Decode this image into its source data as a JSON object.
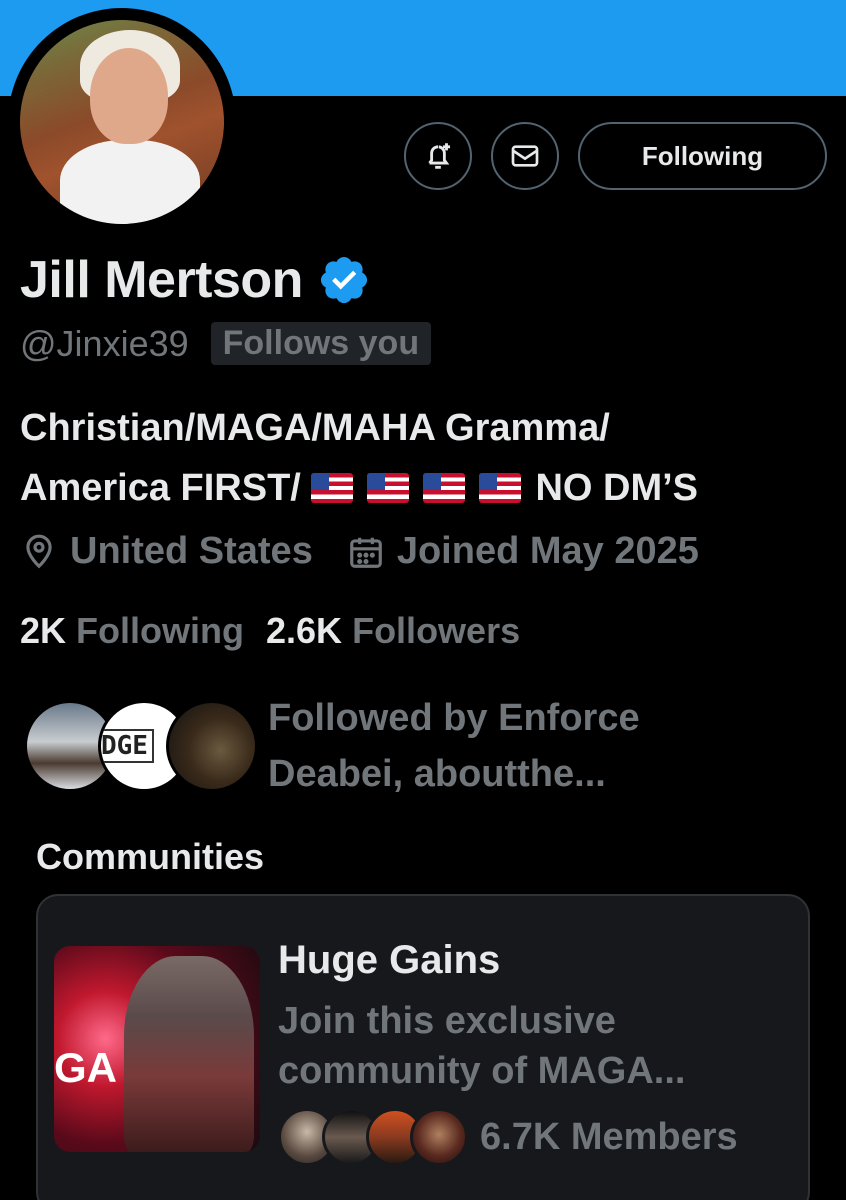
{
  "profile": {
    "name": "Jill Mertson",
    "handle": "@Jinxie39",
    "follows_you": "Follows you",
    "bio_line1": "Christian/MAGA/MAHA Gramma/",
    "bio_line2_prefix": "America FIRST/",
    "bio_line2_suffix": "NO DM’S",
    "location": "United States",
    "joined": "Joined May 2025",
    "verified": true
  },
  "actions": {
    "follow_state": "Following"
  },
  "stats": {
    "following_count": "2K",
    "following_label": "Following",
    "followers_count": "2.6K",
    "followers_label": "Followers"
  },
  "followed_by": {
    "line1": "Followed by Enforce",
    "line2": "Deabei, aboutthe...",
    "avatar2_text": "DGE"
  },
  "communities": {
    "title": "Communities",
    "items": [
      {
        "name": "Huge Gains",
        "desc_line1": "Join this exclusive",
        "desc_line2": "community of MAGA...",
        "members": "6.7K Members",
        "image_text": "GA"
      }
    ]
  },
  "colors": {
    "banner": "#1d9bf0",
    "background": "#000000",
    "primary_text": "#e7e9ea",
    "secondary_text": "#71767b",
    "verified": "#1d9bf0"
  }
}
